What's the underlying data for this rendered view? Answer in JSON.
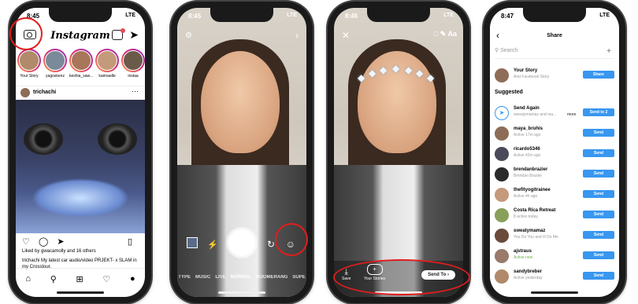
{
  "phone1": {
    "time": "8:45",
    "status_right": "LTE",
    "app_logo": "Instagram",
    "stories": [
      {
        "name": "Your Story"
      },
      {
        "name": "yagoskenz"
      },
      {
        "name": "keshia_saw..."
      },
      {
        "name": "karinaelle"
      },
      {
        "name": "instaa"
      }
    ],
    "post_user": "trichachi",
    "liked_by": "Liked by gwacamolly and 16 others",
    "caption": "trichachi My latest car audio/video PRJEKT- x SLAM in my Crosstour."
  },
  "phone2": {
    "time": "8:45",
    "status_right": "LTE",
    "modes": [
      "TYPE",
      "MUSIC",
      "LIVE",
      "NORMAL",
      "BOOMERANG",
      "SUPE"
    ],
    "active_mode": "NORMAL"
  },
  "phone3": {
    "time": "8:46",
    "status_right": "LTE",
    "text_tool": "Aa",
    "save_label": "Save",
    "your_stories_label": "Your Stories",
    "send_to_label": "Send To"
  },
  "phone4": {
    "time": "8:47",
    "status_right": "LTE",
    "title": "Share",
    "search_placeholder": "Search",
    "your_story": {
      "name": "Your Story",
      "sub": "And Facebook Story",
      "button": "Share"
    },
    "suggested_label": "Suggested",
    "send_again": {
      "name": "Send Again",
      "sub": "sweatymamaz and ma...",
      "more": "more",
      "button": "Send to 2"
    },
    "contacts": [
      {
        "name": "maya_bruhis",
        "sub": "Active 17m ago",
        "active": false,
        "button": "Send"
      },
      {
        "name": "ricardo5346",
        "sub": "Active 42m ago",
        "active": false,
        "button": "Send"
      },
      {
        "name": "brendanbrazier",
        "sub": "Brendan Brazier",
        "active": false,
        "button": "Send"
      },
      {
        "name": "thefityogitrainee",
        "sub": "Active 4h ago",
        "active": false,
        "button": "Send"
      },
      {
        "name": "Costa Rica Retreat",
        "sub": "8 active today",
        "active": false,
        "button": "Send"
      },
      {
        "name": "sweatymamaz",
        "sub": "You Do You and Ill Do Me",
        "active": false,
        "button": "Send"
      },
      {
        "name": "ajstraus",
        "sub": "Active now",
        "active": true,
        "button": "Send"
      },
      {
        "name": "sandybreber",
        "sub": "Active yesterday",
        "active": false,
        "button": "Send"
      }
    ]
  }
}
